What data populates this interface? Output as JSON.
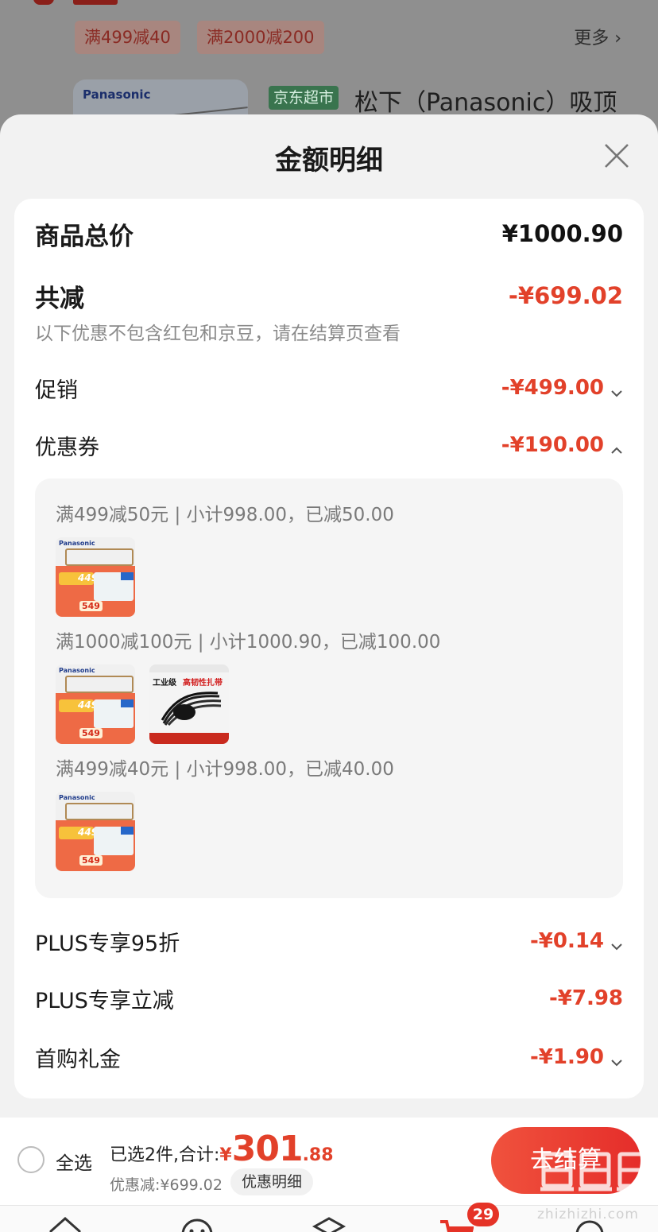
{
  "background": {
    "top_chips": [
      "满499减40",
      "满2000减200"
    ],
    "more_label": "更多",
    "product_badge": "京东超市",
    "product_title": "松下（Panasonic）吸顶",
    "thumb_brand": "Panasonic"
  },
  "sheet": {
    "title": "金额明细",
    "total": {
      "label": "商品总价",
      "amount": "¥1000.90"
    },
    "reduction": {
      "label": "共减",
      "amount": "-¥699.02",
      "note": "以下优惠不包含红包和京豆，请在结算页查看"
    },
    "promo": {
      "label": "促销",
      "amount": "-¥499.00",
      "expanded": false
    },
    "coupon": {
      "label": "优惠券",
      "amount": "-¥190.00",
      "expanded": true,
      "groups": [
        {
          "text": "满499减50元 | 小计998.00，已减50.00",
          "items": [
            "lamp"
          ]
        },
        {
          "text": "满1000减100元 | 小计1000.90，已减100.00",
          "items": [
            "lamp",
            "cable-tie"
          ]
        },
        {
          "text": "满499减40元 | 小计998.00，已减40.00",
          "items": [
            "lamp"
          ]
        }
      ]
    },
    "plus_discount": {
      "label": "PLUS专享95折",
      "amount": "-¥0.14"
    },
    "plus_instant": {
      "label": "PLUS专享立减",
      "amount": "-¥7.98"
    },
    "first_gift": {
      "label": "首购礼金",
      "amount": "-¥1.90"
    }
  },
  "product_thumbs": {
    "lamp": {
      "brand": "Panasonic",
      "price_main": "449",
      "price_tag": "549"
    },
    "tie": {
      "title_a": "工业级",
      "title_b": "高韧性扎带"
    }
  },
  "bottom_bar": {
    "select_all": "全选",
    "summary_prefix": "已选2件,合计:",
    "currency": "¥",
    "total_int": "301",
    "total_dec": ".88",
    "discount_text": "优惠减:¥699.02",
    "detail_button": "优惠明细",
    "checkout_button": "去结算"
  },
  "tabbar": {
    "cart_badge": "29"
  },
  "watermark": {
    "url": "zhizhizhi.com"
  },
  "colors": {
    "accent_red": "#e2412a",
    "sheet_bg": "#f2f2f2",
    "card_bg": "#ffffff"
  }
}
